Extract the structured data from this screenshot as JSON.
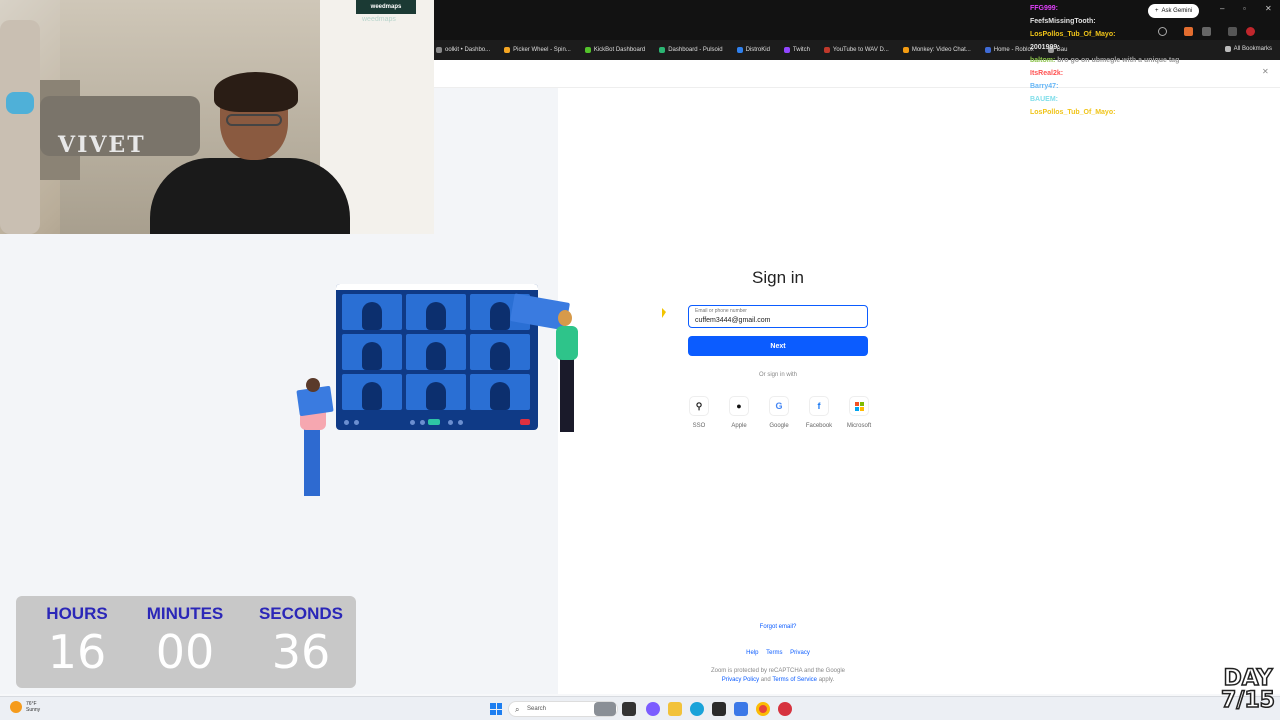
{
  "browser": {
    "ask_gemini": "Ask Gemini",
    "all_bookmarks": "All Bookmarks",
    "bookmarks": [
      "oolkit • Dashbo...",
      "Picker Wheel - Spin...",
      "KickBot Dashboard",
      "Dashboard - Pulsoid",
      "DistroKid",
      "Twitch",
      "YouTube to WAV D...",
      "Monkey: Video Chat...",
      "Home - Roblox",
      "Bau"
    ],
    "bookmark_colors": [
      "#888888",
      "#f5a623",
      "#53c22b",
      "#2bb673",
      "#2f80ed",
      "#9146ff",
      "#c0392b",
      "#f39c12",
      "#3f6bd6",
      "#999999"
    ]
  },
  "webcam": {
    "logo": "weedmaps",
    "shirt_text": "VIVET"
  },
  "chat": [
    {
      "user": "FFG999:",
      "text": "",
      "color": "#e040fb"
    },
    {
      "user": "FeefsMissingTooth:",
      "text": "",
      "color": "#e0e0e0"
    },
    {
      "user": "LosPollos_Tub_Of_Mayo:",
      "text": "",
      "color": "#f0c419"
    },
    {
      "user": "2001999:",
      "text": "",
      "color": "#e0e0e0"
    },
    {
      "user": "baltom:",
      "text": "bro go on ubmegle with a unique tag",
      "color": "#8bc34a"
    },
    {
      "user": "ItsReal2k:",
      "text": "",
      "color": "#ff5252"
    },
    {
      "user": "Barry47:",
      "text": "",
      "color": "#64b5f6"
    },
    {
      "user": "BAUEM:",
      "text": "",
      "color": "#80deea"
    },
    {
      "user": "LosPollos_Tub_Of_Mayo:",
      "text": "",
      "color": "#f0c419"
    }
  ],
  "signin": {
    "title": "Sign in",
    "email_label": "Email or phone number",
    "email_value": "cuffem3444@gmail.com",
    "next_label": "Next",
    "or_sign_in_with": "Or sign in with",
    "providers": [
      {
        "label": "SSO",
        "icon": "key-icon",
        "glyph": "🔑",
        "color": "#222"
      },
      {
        "label": "Apple",
        "icon": "apple-icon",
        "glyph": "",
        "color": "#111"
      },
      {
        "label": "Google",
        "icon": "google-icon",
        "glyph": "G",
        "color": "#4285f4"
      },
      {
        "label": "Facebook",
        "icon": "facebook-icon",
        "glyph": "f",
        "color": "#1877f2"
      },
      {
        "label": "Microsoft",
        "icon": "microsoft-icon",
        "glyph": "■",
        "color": "#f25022"
      }
    ],
    "forgot_email": "Forgot email?",
    "footer_links": [
      "Help",
      "Terms",
      "Privacy"
    ],
    "recaptcha_line1": "Zoom is protected by reCAPTCHA and the Google",
    "privacy_policy": "Privacy Policy",
    "and": "and",
    "terms_of_service": "Terms of Service",
    "apply": "apply."
  },
  "timer": {
    "hours_label": "HOURS",
    "minutes_label": "MINUTES",
    "seconds_label": "SECONDS",
    "hours": "16",
    "minutes": "00",
    "seconds": "36"
  },
  "day_overlay": {
    "line1": "DAY",
    "line2": "7/15"
  },
  "taskbar": {
    "weather_temp": "76°F",
    "weather_cond": "Sunny",
    "search_placeholder": "Search"
  },
  "colors": {
    "zoom_blue": "#0b5cff",
    "timer_label": "#2b27b8"
  }
}
